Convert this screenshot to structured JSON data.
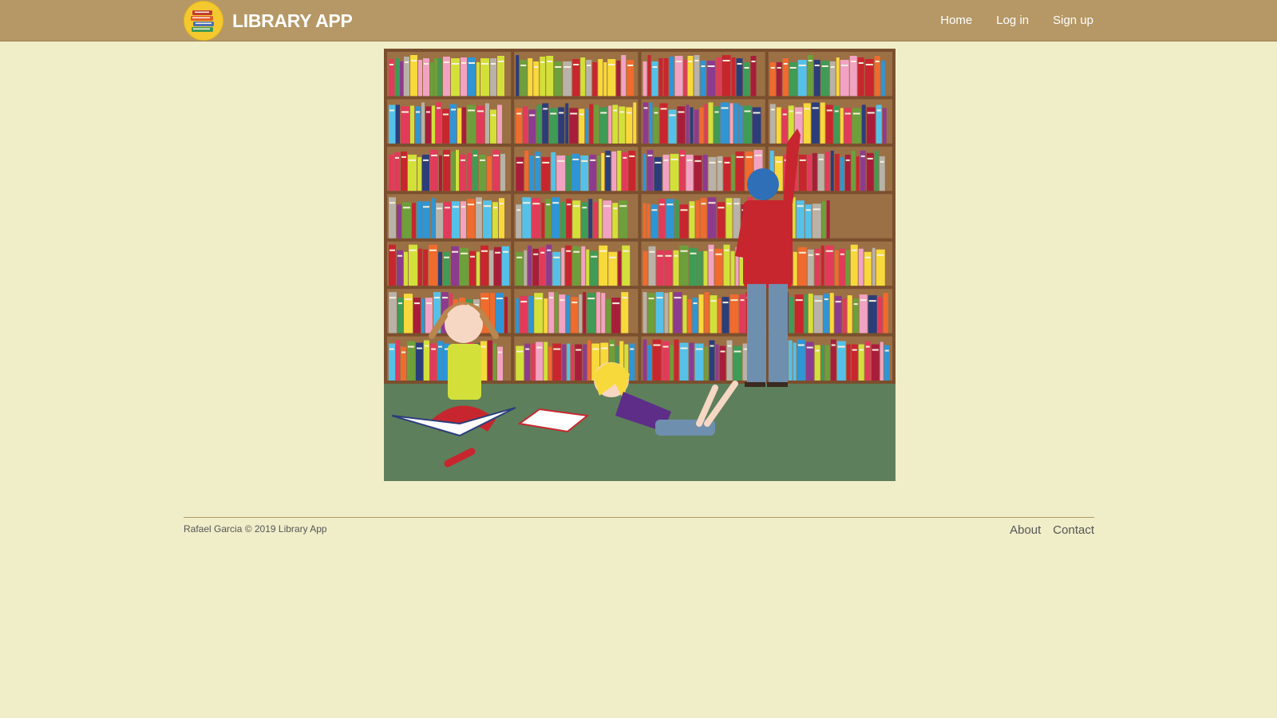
{
  "header": {
    "brand": "LIBRARY APP",
    "nav": [
      {
        "label": "Home"
      },
      {
        "label": "Log in"
      },
      {
        "label": "Sign up"
      }
    ]
  },
  "footer": {
    "copyright": "Rafael Garcia © 2019 Library App",
    "links": [
      {
        "label": "About"
      },
      {
        "label": "Contact"
      }
    ]
  },
  "colors": {
    "navbar": "#b59865",
    "page_background": "#f0eec9",
    "footer_text": "#555555"
  },
  "icons": {
    "logo": "stacked-books-icon"
  }
}
